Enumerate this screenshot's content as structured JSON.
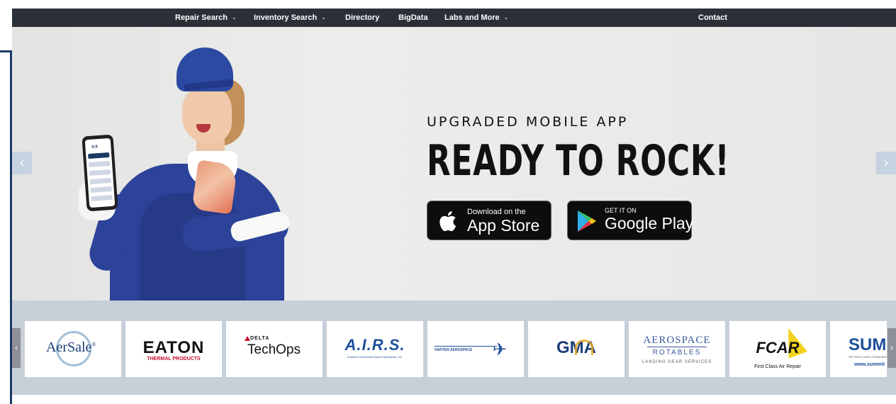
{
  "nav": {
    "items": [
      {
        "label": "Repair Search",
        "has_dropdown": true
      },
      {
        "label": "Inventory Search",
        "has_dropdown": true
      },
      {
        "label": "Directory",
        "has_dropdown": false
      },
      {
        "label": "BigData",
        "has_dropdown": false
      },
      {
        "label": "Labs and More",
        "has_dropdown": true
      }
    ],
    "contact": "Contact",
    "caret": "⌄"
  },
  "hero": {
    "subtitle": "UPGRADED MOBILE APP",
    "title": "READY TO ROCK!",
    "app_store": {
      "small": "Download on the",
      "big": "App Store"
    },
    "google_play": {
      "small": "GET IT ON",
      "big": "Google Play"
    },
    "phone_logo": "ILS",
    "prev_arrow": "‹",
    "next_arrow": "›"
  },
  "logos": {
    "prev_arrow": "‹",
    "next_arrow": "›",
    "aersale": {
      "name": "AerSale",
      "mark": "®"
    },
    "eaton": {
      "name": "EATON",
      "sub": "THERMAL PRODUCTS"
    },
    "delta": {
      "small": "DELTA",
      "name": "TechOps"
    },
    "airs": {
      "name": "A.I.R.S.",
      "sub": "Aviation Instruments Repair Specialists, Inc."
    },
    "harter": {
      "name": "HARTER AEROSPACE"
    },
    "gma": {
      "name": "GMA"
    },
    "aerospace": {
      "name": "AEROSPACE",
      "rotables": "ROTABLES",
      "sub": "LANDING GEAR SERVICES"
    },
    "fcar": {
      "name": "FCAR",
      "sub": "First Class Air Repair"
    },
    "summit": {
      "name": "SUMM",
      "sub": "SETTING A NEW STANDARD",
      "url": "www.summit"
    }
  },
  "colors": {
    "nav_bg": "#2b3038",
    "accent_navy": "#1b3a64",
    "strip_bg": "#c7cfd9",
    "arrow_bg": "#c5d2e0"
  },
  "icons": {
    "apple": "apple-icon",
    "google_play": "google-play-icon",
    "plane": "airplane-icon"
  }
}
